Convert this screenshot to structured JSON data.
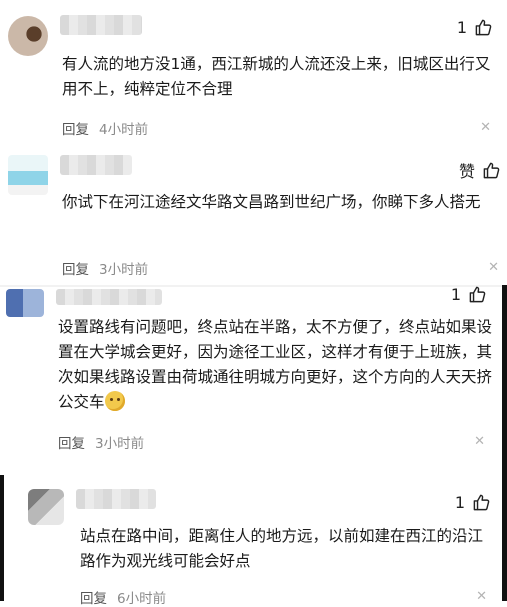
{
  "comments": [
    {
      "likes": "1",
      "text": "有人流的地方没1通，西江新城的人流还没上来，旧城区出行又用不上，纯粹定位不合理",
      "reply": "回复",
      "time": "4小时前"
    },
    {
      "likes": "赞",
      "text": "你试下在河江途经文华路文昌路到世纪广场，你睇下多人搭无",
      "reply": "回复",
      "time": "3小时前"
    },
    {
      "likes": "1",
      "text": "设置路线有问题吧，终点站在半路，太不方便了，终点站如果设置在大学城会更好，因为途径工业区，这样才有便于上班族，其次如果线路设置由荷城通往明城方向更好，这个方向的人天天挤公交车",
      "emoji": "thinking-face-emoji",
      "reply": "回复",
      "time": "3小时前"
    },
    {
      "likes": "1",
      "text": "站点在路中间，距离住人的地方远，以前如建在西江的沿江路作为观光线可能会好点",
      "reply": "回复",
      "time": "6小时前"
    }
  ],
  "icons": {
    "like": "thumbs-up-icon",
    "close": "close-icon"
  }
}
